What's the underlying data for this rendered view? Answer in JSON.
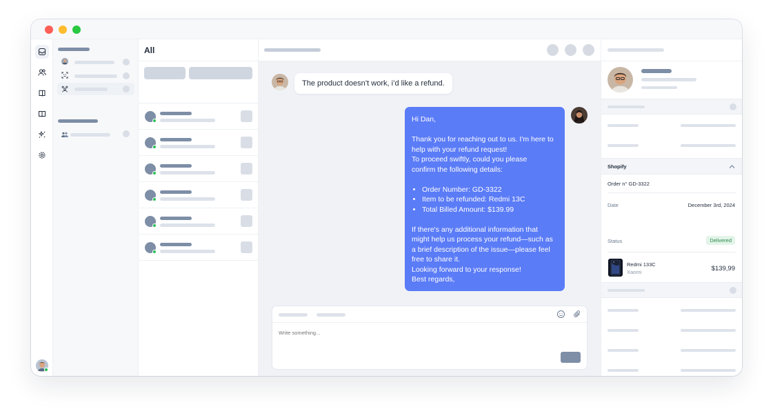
{
  "window": {
    "controls": [
      "close",
      "minimize",
      "maximize"
    ]
  },
  "rail": {
    "icons": [
      "inbox-icon",
      "users-icon",
      "book-open-icon",
      "book-icon",
      "sparkles-icon",
      "gear-icon"
    ],
    "active_index": 0
  },
  "conversation_list": {
    "title": "All",
    "row_count": 6
  },
  "chat": {
    "incoming_message": "The product doesn’t work, i’d like a refund.",
    "reply": {
      "greeting": "Hi Dan,",
      "para1": [
        "Thank you for reaching out to us. I'm here to",
        "help with your refund request!",
        "To proceed swiftly, could you please",
        "confirm the following details:"
      ],
      "bullets": [
        "Order Number: GD-3322",
        "Item to be refunded: Redmi 13C",
        "Total Billed Amount: $139.99"
      ],
      "para2": [
        "If there's any additional information that",
        "might help us process your refund—such as",
        "a brief description of the issue—please feel",
        "free to share it.",
        "Looking forward to your response!",
        "Best regards,"
      ]
    },
    "composer": {
      "placeholder": "Write something..."
    }
  },
  "profile": {
    "integration": {
      "name": "Shopify",
      "order_label": "Order n° GD-3322",
      "date_label": "Date",
      "date_value": "December 3rd, 2024",
      "status_label": "Status",
      "status_value": "Delivered",
      "product_name": "Redmi 133C",
      "product_brand": "Xaomi",
      "product_price": "$139,99"
    }
  },
  "colors": {
    "accent": "#5b7cf7",
    "placeholder_dark": "#7d8ea6",
    "placeholder_light": "#dde2ea",
    "online": "#2ec05a",
    "status_delivered": "#2d8a4e"
  }
}
